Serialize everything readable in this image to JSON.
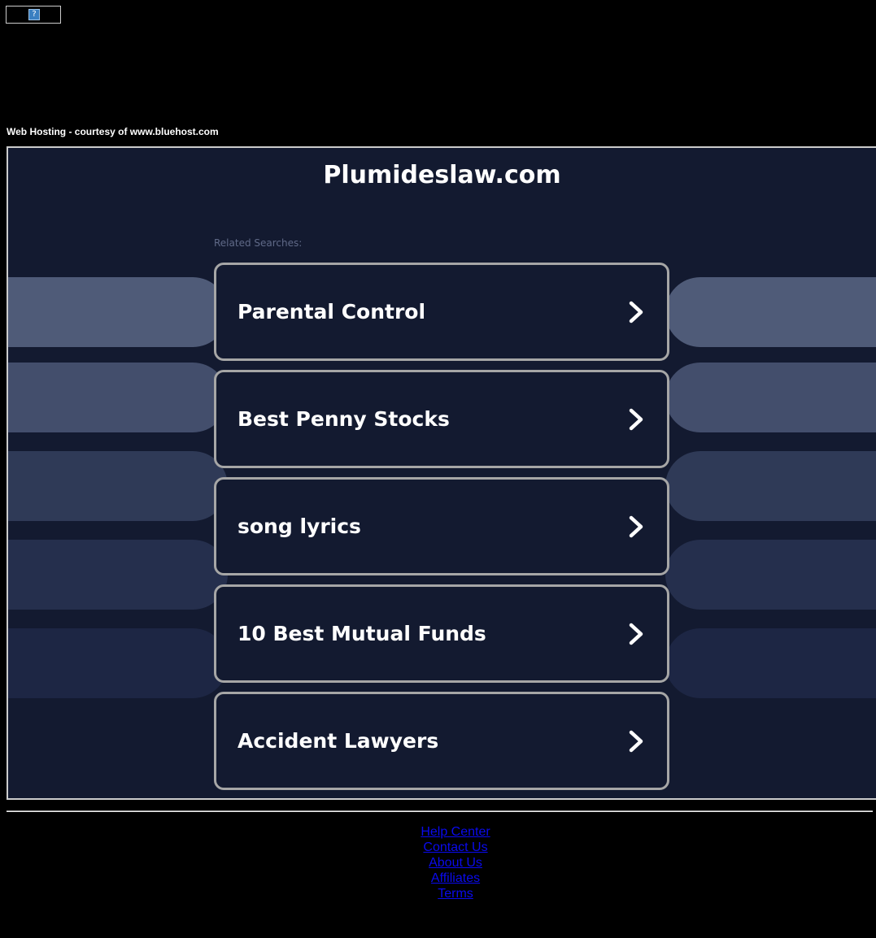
{
  "banner": {
    "icon": "broken-image-icon",
    "glyph": "?"
  },
  "hosting_text": "Web Hosting - courtesy of www.bluehost.com",
  "domain_title": "Plumideslaw.com",
  "related_label": "Related Searches:",
  "searches": [
    {
      "label": "Parental Control"
    },
    {
      "label": "Best Penny Stocks"
    },
    {
      "label": "song lyrics"
    },
    {
      "label": "10 Best Mutual Funds"
    },
    {
      "label": "Accident Lawyers"
    }
  ],
  "footer_links": [
    "Help Center",
    "Contact Us",
    "About Us",
    "Affiliates",
    "Terms"
  ],
  "colors": {
    "page_background": "#000000",
    "panel_background": "#131a30",
    "card_border": "#a6a6a6",
    "link": "#0a0aee",
    "pill_shades": [
      "#4f5b78",
      "#434e6c",
      "#2f3a57",
      "#252f4d",
      "#1d2644"
    ]
  }
}
